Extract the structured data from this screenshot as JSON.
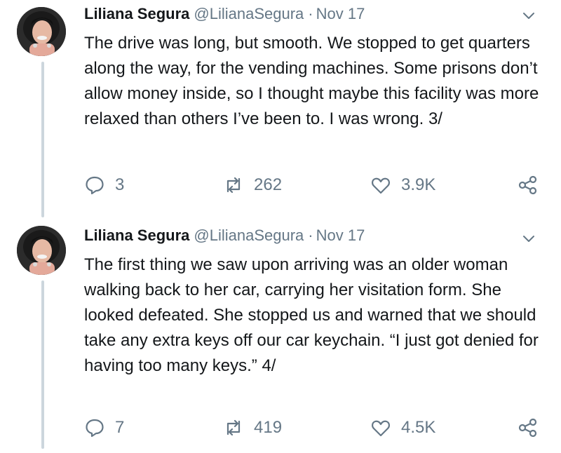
{
  "colors": {
    "text_primary": "#14171a",
    "text_secondary": "#657786",
    "thread_line": "#ccd6dd",
    "icon": "#657786"
  },
  "tweets": [
    {
      "name": "Liliana Segura",
      "handle": "@LilianaSegura",
      "separator": "·",
      "date": "Nov 17",
      "text": "The drive was long, but smooth. We stopped to get quarters along the way, for the vending machines. Some prisons don’t allow money inside, so I thought maybe this facility was more relaxed than others I’ve been to. I was wrong. 3/",
      "replies": "3",
      "retweets": "262",
      "likes": "3.9K",
      "icons": {
        "reply": "reply-icon",
        "retweet": "retweet-icon",
        "like": "heart-icon",
        "share": "share-icon",
        "menu": "chevron-down-icon"
      }
    },
    {
      "name": "Liliana Segura",
      "handle": "@LilianaSegura",
      "separator": "·",
      "date": "Nov 17",
      "text": "The first thing we saw upon arriving was an older woman walking back to her car, carrying her visitation form. She looked defeated. She stopped us and warned that we should take any extra keys off our car keychain. “I just got denied for having too many keys.” 4/",
      "replies": "7",
      "retweets": "419",
      "likes": "4.5K",
      "icons": {
        "reply": "reply-icon",
        "retweet": "retweet-icon",
        "like": "heart-icon",
        "share": "share-icon",
        "menu": "chevron-down-icon"
      }
    }
  ]
}
